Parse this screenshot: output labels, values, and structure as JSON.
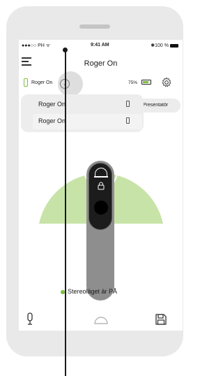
{
  "status_bar": {
    "carrier": "●●●○○ PH ᯤ",
    "time": "9:41 AM",
    "battery": "✱100 %"
  },
  "nav": {
    "title": "Roger On",
    "menu_icon": "hamburger-menu-icon"
  },
  "device": {
    "name": "Roger On",
    "battery_percent": "75%",
    "battery_level": 0.75,
    "settings_icon": "gear-icon",
    "expand_icon": "chevron-down-icon"
  },
  "dropdown": {
    "items": [
      {
        "label": "Roger On",
        "icon": "battery-icon"
      },
      {
        "label": "Roger On",
        "icon": "battery-icon"
      }
    ]
  },
  "presentator_label": "Presentatör",
  "stereo": {
    "status_text": "Stereoläget är PÅ",
    "status_color": "#7dbd3c"
  },
  "tabbar": {
    "items": [
      "microphone-icon",
      "dome-icon",
      "save-icon"
    ]
  },
  "colors": {
    "accent": "#7dbd3c",
    "fan": "#c8e3a7",
    "device": "#8e8e8e"
  }
}
